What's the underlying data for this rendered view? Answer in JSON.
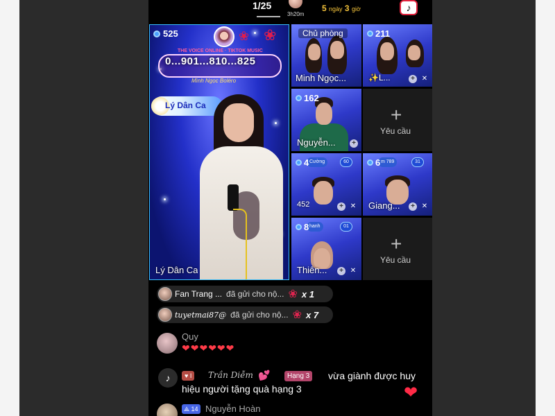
{
  "topbar": {
    "page_counter": "1/25",
    "host_duration": "3h20m",
    "countdown_days": "5",
    "countdown_day_unit": "ngày",
    "countdown_hours": "3",
    "countdown_hour_unit": "giờ",
    "tiktok_icon": "tiktok-icon"
  },
  "main_tile": {
    "viewers": "525",
    "banner_top": "THE VOICE ONLINE · TIKTOK MUSIC",
    "banner_number": "0...901...810...825",
    "banner_sub": "Mình Ngọc Boléro",
    "song_title": "Lý Dân Ca",
    "name": "Lý Dân Ca"
  },
  "tiles": [
    {
      "label": "Chủ phòng",
      "name": "Minh Ngọc..."
    },
    {
      "viewers": "211",
      "name": "✨L..."
    },
    {
      "viewers": "162",
      "name": "Nguyễn..."
    },
    {
      "request_label": "Yêu cầu"
    },
    {
      "viewers": "4",
      "score": "60",
      "name": "452"
    },
    {
      "viewers": "6",
      "score": "31",
      "name": "Giang..."
    },
    {
      "viewers": "8",
      "score": "01",
      "name": "Thiên..."
    },
    {
      "request_label": "Yêu cầu"
    }
  ],
  "gifts": [
    {
      "user": "Fan Trang ...",
      "action": "đã gửi cho nộ...",
      "count": "x 1"
    },
    {
      "user": "tuyetmai87@",
      "action": "đã gửi cho nộ...",
      "count": "x 7"
    }
  ],
  "comments": {
    "first_user": "Quy",
    "first_message": "❤❤❤❤❤❤",
    "system_fan_level": "I",
    "system_user": "Trần Diễm",
    "system_rank": "Hạng 3",
    "system_message": "vừa giành được huy hiệu người tặng quà hạng 3",
    "last_level": "14",
    "last_user": "Nguyễn Hoàn"
  },
  "colors": {
    "accent_gold": "#f3c23a",
    "tile_blue": "#2e39c9",
    "heart_red": "#ff2a46"
  }
}
